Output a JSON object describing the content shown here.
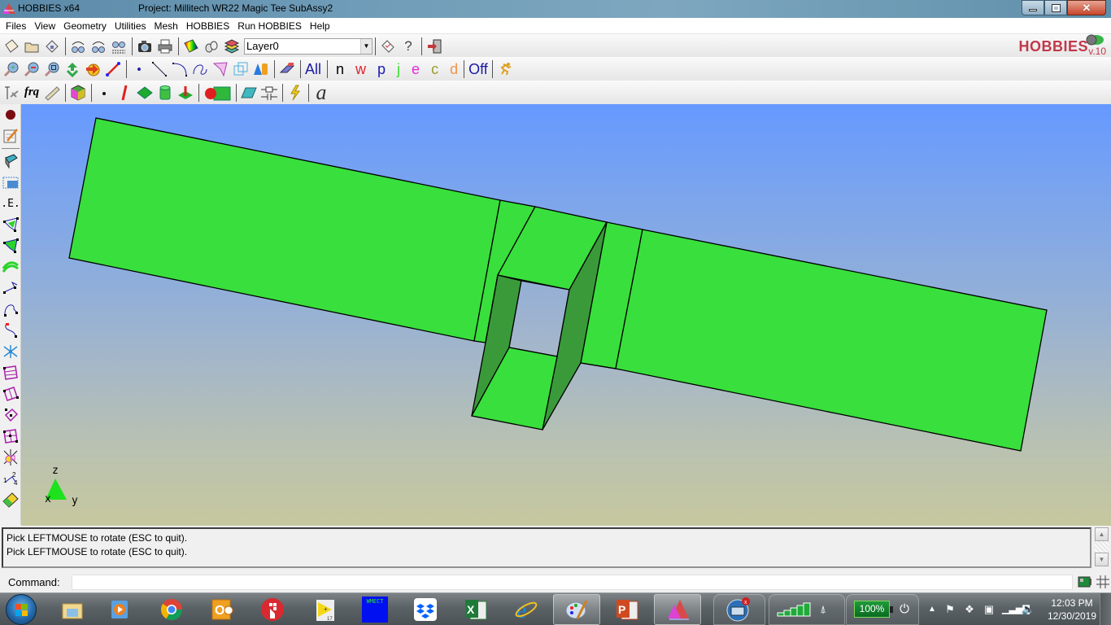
{
  "window": {
    "app_name": "HOBBIES x64",
    "project_title": "Project: Millitech WR22 Magic Tee SubAssy2",
    "controls": [
      "minimize",
      "restore",
      "close"
    ]
  },
  "menu": [
    "Files",
    "View",
    "Geometry",
    "Utilities",
    "Mesh",
    "HOBBIES",
    "Run HOBBIES",
    "Help"
  ],
  "brand": {
    "name": "HOBBIES",
    "version": "v.10",
    "color": "#c0394a"
  },
  "toolbar1": {
    "icons": [
      "new-icon",
      "open-folder-icon",
      "save-icon",
      "undo-icon",
      "redo-icon",
      "undo-list-icon",
      "camera-icon",
      "print-icon",
      "color-palette-icon",
      "binoculars-icon",
      "layers-icon"
    ],
    "layer_select": {
      "value": "Layer0"
    },
    "icons_after": [
      "properties-check-icon",
      "help-icon",
      "exit-icon"
    ]
  },
  "toolbar2": {
    "icons": [
      "zoom-in-icon",
      "zoom-out-icon",
      "zoom-fit-icon",
      "refresh-icon",
      "rotate-view-icon",
      "vector-arrow-icon",
      "point-icon",
      "line-icon",
      "arc-icon",
      "spline-icon",
      "surface-patch-icon",
      "wire-box-icon",
      "solid-shapes-icon",
      "eraser-icon"
    ],
    "filters": [
      {
        "label": "All",
        "color": "#1a1aa6"
      },
      {
        "label": "n",
        "color": "#000000"
      },
      {
        "label": "w",
        "color": "#e0242c"
      },
      {
        "label": "p",
        "color": "#1a1ab4"
      },
      {
        "label": "j",
        "color": "#3adf2a"
      },
      {
        "label": "e",
        "color": "#e826e0"
      },
      {
        "label": "c",
        "color": "#9a9a2a"
      },
      {
        "label": "d",
        "color": "#f2954a"
      }
    ],
    "off_label": "Off",
    "last_icon": "running-man-icon"
  },
  "toolbar3": {
    "icons": [
      "antenna-plane-icon",
      "frequency-icon",
      "ruler-icon",
      "material-cube-icon",
      "node-icon",
      "wire-icon",
      "plate-icon",
      "cylinder-icon",
      "ground-plane-icon",
      "sphere-box-icon",
      "parallelogram-icon",
      "lumped-load-icon",
      "excitation-icon",
      "font-icon"
    ],
    "frq_label": "frq",
    "font_label": "a"
  },
  "left_toolbar": [
    "record-icon",
    "edit-sheet-icon",
    "eraser-3d-icon",
    "select-box-icon",
    "edge-icon",
    "quad-surface-icon",
    "quad-surface-filled-icon",
    "multi-surface-icon",
    "polyline-icon",
    "curve-icon",
    "curve-marked-icon",
    "split-icon",
    "bilinear-surface-icon",
    "twisted-surface-icon",
    "plate-node-icon",
    "mesh-surface-icon",
    "star-junction-icon",
    "node-numbering-icon",
    "pcb-icon"
  ],
  "viewport": {
    "model_color": "#39df3c",
    "shade_color": "#3a9a3a",
    "axes": {
      "x": "x",
      "y": "y",
      "z": "z"
    }
  },
  "console": {
    "lines": [
      "Pick LEFTMOUSE to rotate (ESC to quit).",
      "Pick LEFTMOUSE to rotate (ESC to quit)."
    ]
  },
  "command": {
    "label": "Command:",
    "value": ""
  },
  "taskbar": {
    "apps": [
      "windows-explorer",
      "windows-media-player",
      "google-chrome",
      "outlook",
      "app-red-circle",
      "labview-17",
      "wmect",
      "dropbox",
      "excel",
      "internet-explorer",
      "paint",
      "powerpoint",
      "hobbies",
      "network-toolbox"
    ],
    "wmect_label": "WMECT",
    "labview_label": "17",
    "battery": "100%",
    "time": "12:03 PM",
    "date": "12/30/2019"
  }
}
